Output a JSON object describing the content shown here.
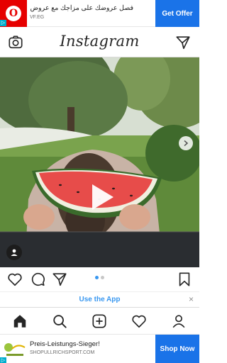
{
  "ad_top": {
    "logo_glyph": "O",
    "headline": "فصل عروضك على مزاجك مع عروض 365",
    "source": "VF.EG",
    "cta_label": "Get Offer",
    "corner_glyph": "▷",
    "brand_color": "#e60000",
    "cta_color": "#1a73e8"
  },
  "header": {
    "brand": "Instagram",
    "left_icon": "camera-icon",
    "right_icon": "direct-send-icon"
  },
  "post": {
    "media_type": "video",
    "carousel_index": 1,
    "carousel_count": 2
  },
  "actions": {
    "icons": [
      "heart-icon",
      "comment-icon",
      "share-icon",
      "bookmark-icon"
    ]
  },
  "use_app": {
    "label": "Use the App",
    "close_glyph": "×",
    "accent_color": "#3897f0"
  },
  "bottom_nav": {
    "icons": [
      "home-icon",
      "search-icon",
      "add-post-icon",
      "activity-heart-icon",
      "profile-icon"
    ]
  },
  "ad_bottom": {
    "title": "Preis-Leistungs-Sieger!",
    "site": "SHOPULLRICHSPORT.COM",
    "cta_label": "Shop Now",
    "corner_glyph": "▷",
    "cta_color": "#1a73e8"
  }
}
